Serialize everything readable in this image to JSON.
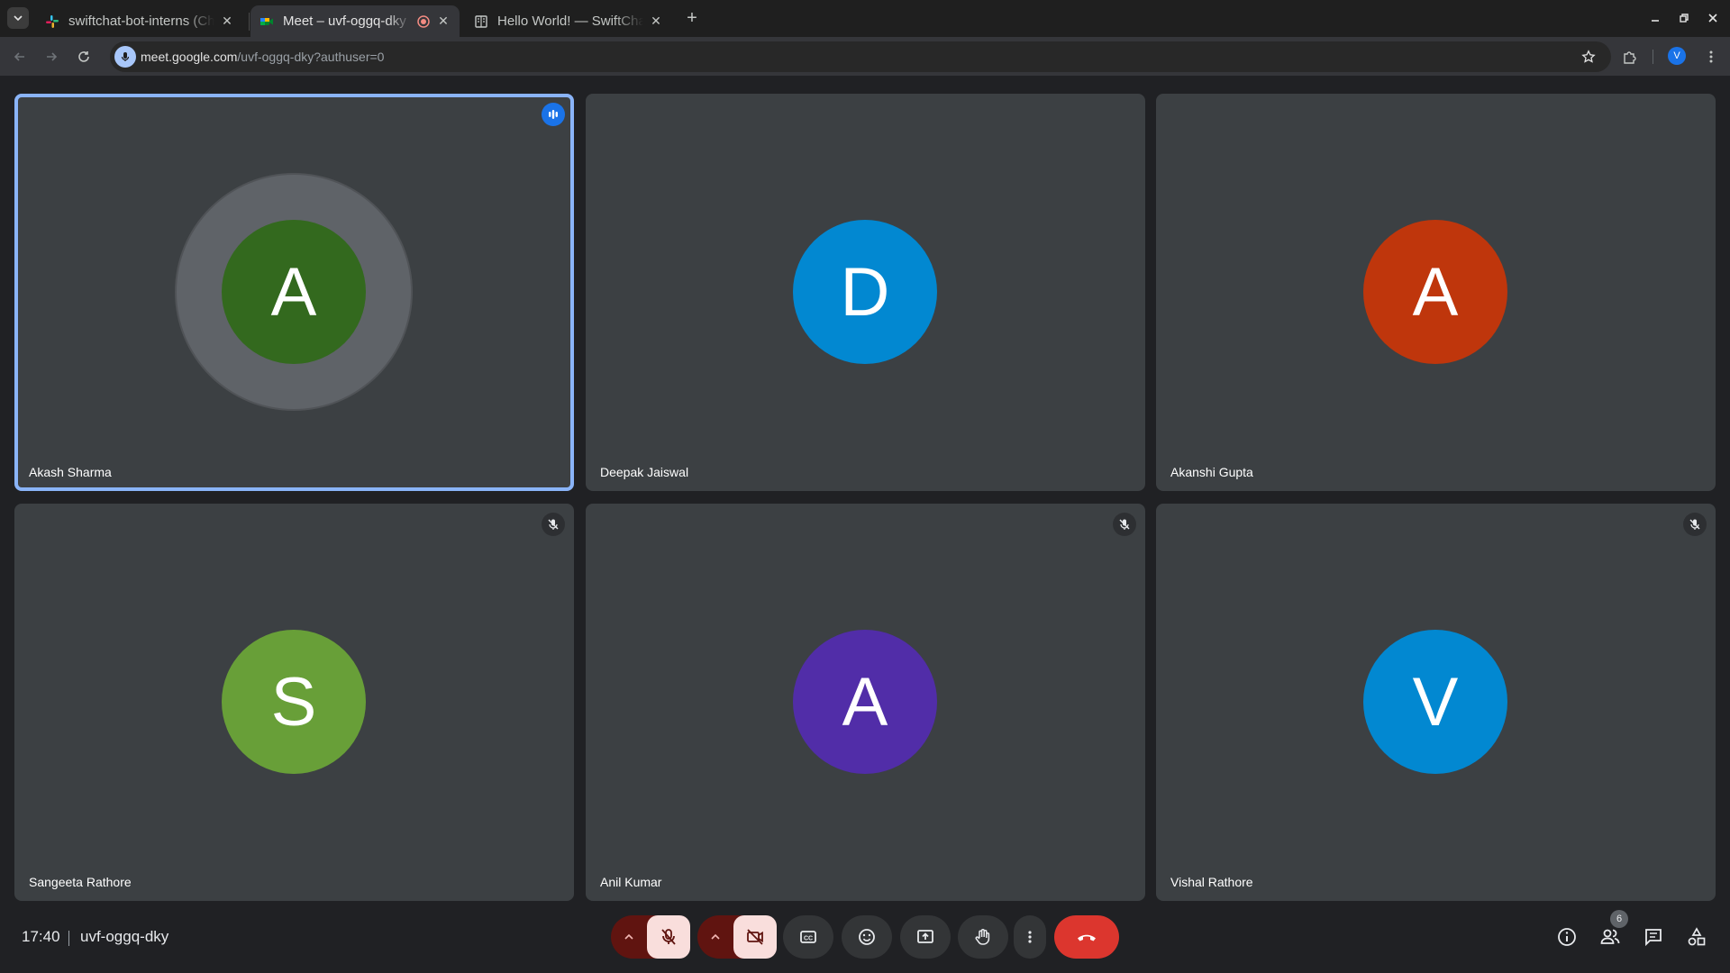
{
  "browser": {
    "tabs": [
      {
        "title": "swiftchat-bot-interns (Ch",
        "active": false,
        "favicon": "slack-icon"
      },
      {
        "title": "Meet – uvf-oggq-dky",
        "active": true,
        "favicon": "meet-icon"
      },
      {
        "title": "Hello World! — SwiftCha",
        "active": false,
        "favicon": "document-icon"
      }
    ],
    "url_host": "meet.google.com",
    "url_path": "/uvf-oggq-dky?authuser=0",
    "profile_initial": "V"
  },
  "meeting": {
    "participants": [
      {
        "name": "Akash Sharma",
        "initial": "A",
        "color": "#33691e",
        "speaking": true,
        "muted": false
      },
      {
        "name": "Deepak Jaiswal",
        "initial": "D",
        "color": "#0288d1",
        "speaking": false,
        "muted": false
      },
      {
        "name": "Akanshi Gupta",
        "initial": "A",
        "color": "#bf360c",
        "speaking": false,
        "muted": false
      },
      {
        "name": "Sangeeta Rathore",
        "initial": "S",
        "color": "#689f38",
        "speaking": false,
        "muted": true
      },
      {
        "name": "Anil Kumar",
        "initial": "A",
        "color": "#512da8",
        "speaking": false,
        "muted": true
      },
      {
        "name": "Vishal Rathore",
        "initial": "V",
        "color": "#0288d1",
        "speaking": false,
        "muted": true
      }
    ]
  },
  "bottom_bar": {
    "time": "17:40",
    "meeting_code": "uvf-oggq-dky",
    "people_count": "6"
  },
  "colors": {
    "accent": "#8ab4f8",
    "end_call": "#dc362e",
    "tile_bg": "#3c4043"
  }
}
